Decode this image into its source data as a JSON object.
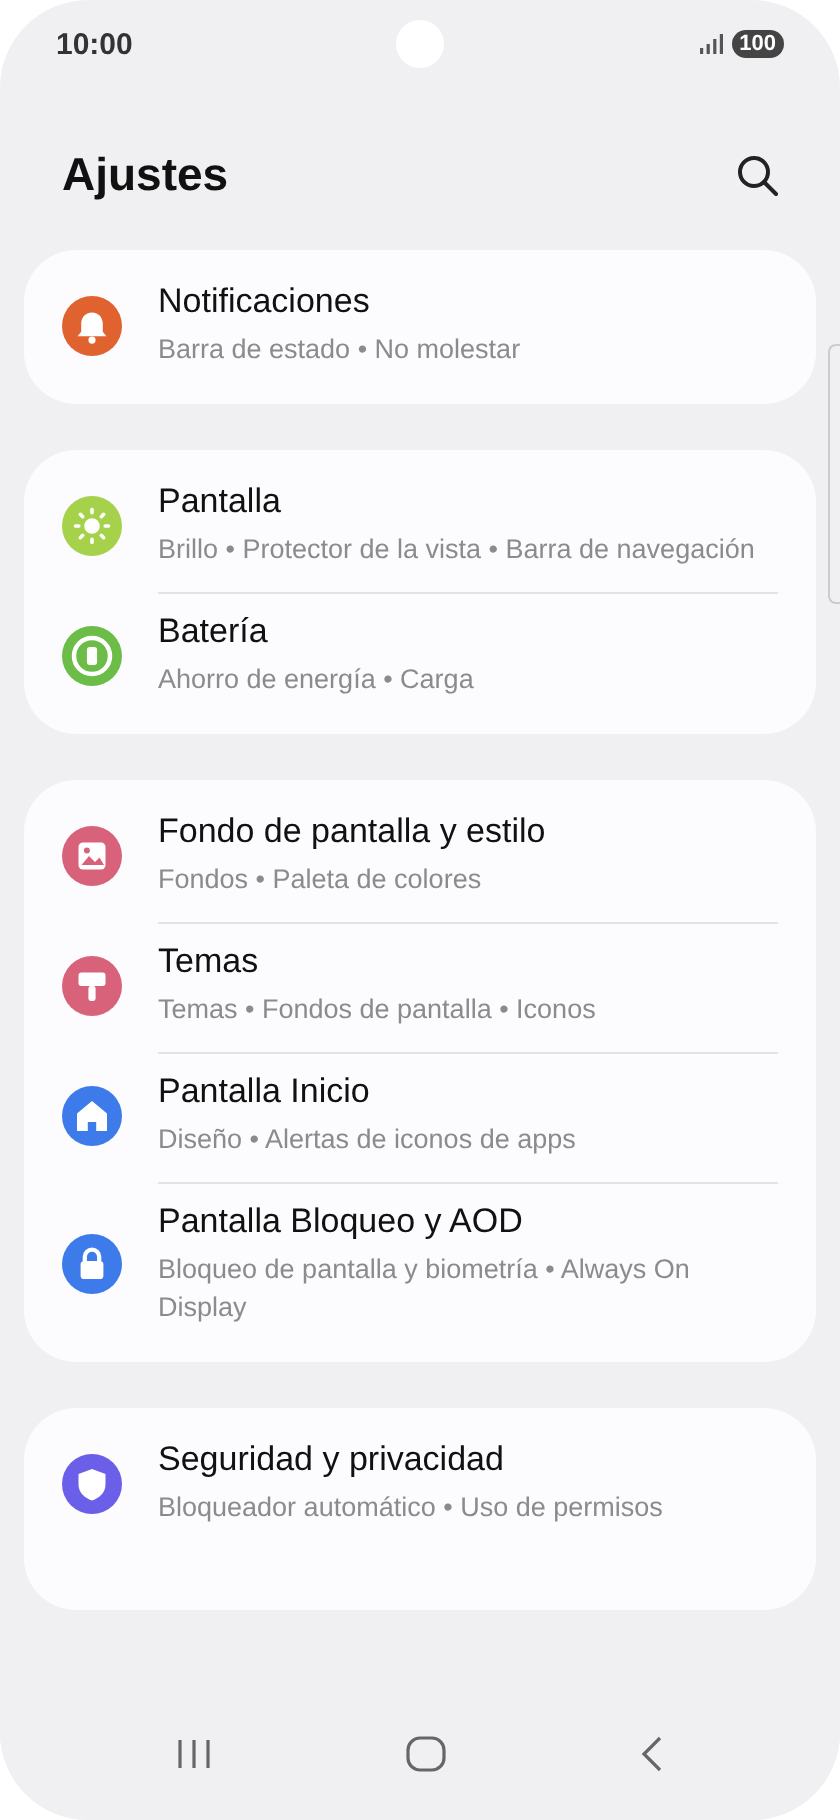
{
  "status_bar": {
    "time": "10:00",
    "battery": "100"
  },
  "header": {
    "title": "Ajustes"
  },
  "groups": [
    {
      "items": [
        {
          "title": "Notificaciones",
          "subtitle": "Barra de estado • No molestar",
          "color": "#e0622f"
        }
      ]
    },
    {
      "items": [
        {
          "title": "Pantalla",
          "subtitle": "Brillo • Protector de la vista • Barra de navegación",
          "color": "#a5d24a"
        },
        {
          "title": "Batería",
          "subtitle": "Ahorro de energía • Carga",
          "color": "#6cbd47"
        }
      ]
    },
    {
      "items": [
        {
          "title": "Fondo de pantalla y estilo",
          "subtitle": "Fondos • Paleta de colores",
          "color": "#d9627b"
        },
        {
          "title": "Temas",
          "subtitle": "Temas • Fondos de pantalla • Iconos",
          "color": "#d9627b"
        },
        {
          "title": "Pantalla Inicio",
          "subtitle": "Diseño • Alertas de iconos de apps",
          "color": "#3e7bea"
        },
        {
          "title": "Pantalla Bloqueo y AOD",
          "subtitle": "Bloqueo de pantalla y biometría • Always On Display",
          "color": "#3e7bea"
        }
      ]
    },
    {
      "items": [
        {
          "title": "Seguridad y privacidad",
          "subtitle": "Bloqueador automático • Uso de permisos",
          "color": "#6b5ee8"
        }
      ]
    }
  ]
}
